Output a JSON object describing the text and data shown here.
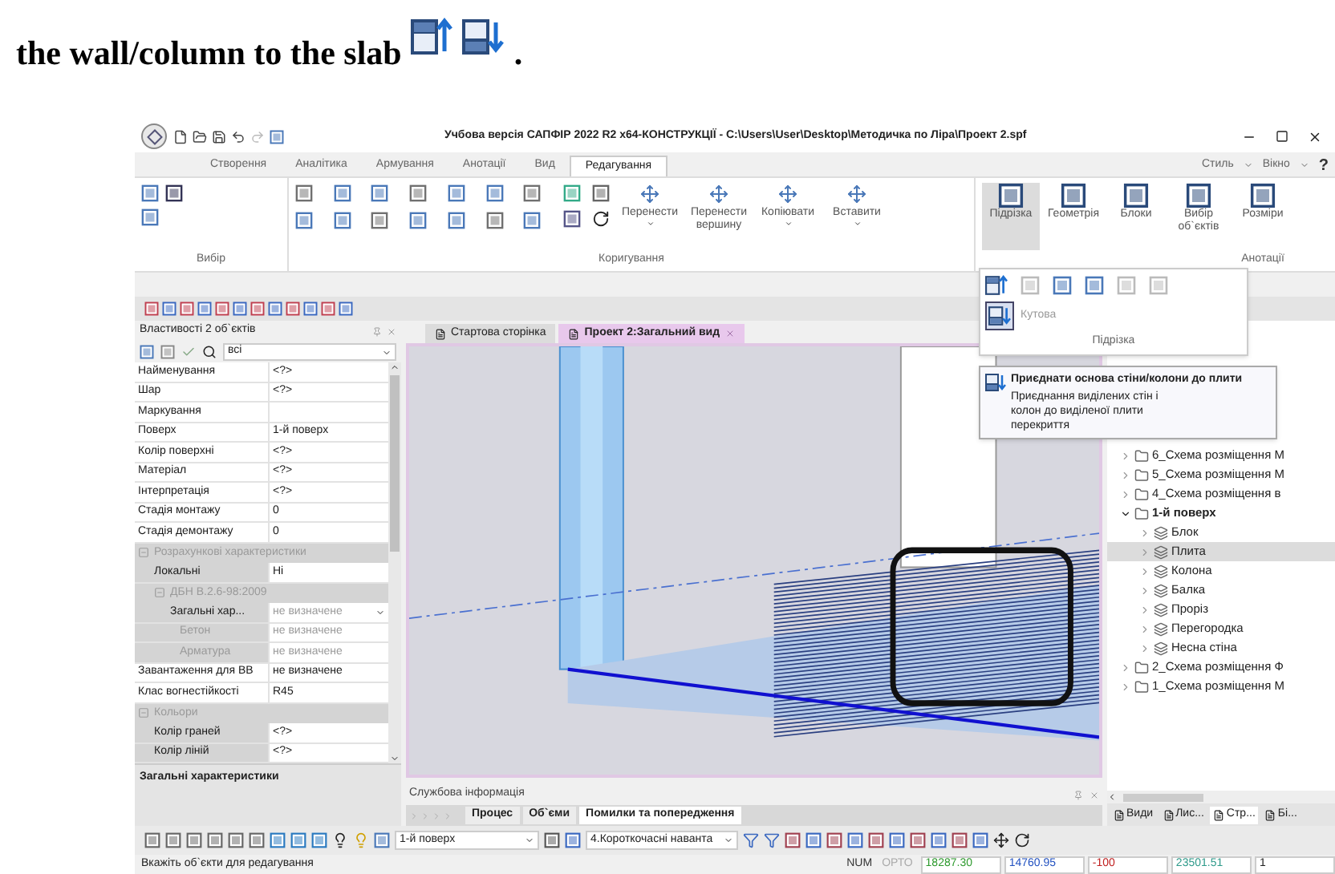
{
  "caption": {
    "text": "the wall/column to the slab",
    "end": "."
  },
  "window": {
    "title": "Учбова версія САПФІР 2022 R2 x64-КОНСТРУКЦІЇ - C:\\Users\\User\\Desktop\\Методичка по Ліра\\Проект 2.spf"
  },
  "ribbon_tabs": [
    {
      "label": "Створення",
      "selected": false
    },
    {
      "label": "Аналітика",
      "selected": false
    },
    {
      "label": "Армування",
      "selected": false
    },
    {
      "label": "Анотації",
      "selected": false
    },
    {
      "label": "Вид",
      "selected": false
    },
    {
      "label": "Редагування",
      "selected": true
    }
  ],
  "menu_right": [
    {
      "label": "Стиль",
      "dropdown": true
    },
    {
      "label": "Вікно",
      "dropdown": true
    },
    {
      "label": "?",
      "dropdown": false
    }
  ],
  "ribbon": {
    "select_group": "Вибір",
    "edit_group": "Коригування",
    "edit_buttons": [
      {
        "label": "Перенести",
        "dropdown": true
      },
      {
        "label": "Перенести вершину",
        "dropdown": false
      },
      {
        "label": "Копіювати",
        "dropdown": true
      },
      {
        "label": "Вставити",
        "dropdown": true
      }
    ],
    "large_buttons": [
      {
        "label": "Підрізка",
        "selected": true
      },
      {
        "label": "Геометрія",
        "selected": false
      },
      {
        "label": "Блоки",
        "selected": false
      },
      {
        "label": "Вибір об`єктів",
        "selected": false
      },
      {
        "label": "Розміри",
        "selected": false
      }
    ],
    "annot_group": "Анотації"
  },
  "trim_menu": {
    "button": "Кутова",
    "group": "Підрізка"
  },
  "tooltip": {
    "title": "Приєднати основа стіни/колони до плити",
    "body": "Приєднання виділених стін і колон до виділеної плити перекриття"
  },
  "properties": {
    "title": "Властивості 2 об`єктів",
    "filter": "всі",
    "description": "Загальні характеристики",
    "rows": [
      {
        "kind": "prop",
        "name": "Найменування",
        "value": "<?>"
      },
      {
        "kind": "prop",
        "name": "Шар",
        "value": "<?>"
      },
      {
        "kind": "prop",
        "name": "Маркування"
      },
      {
        "kind": "prop",
        "name": "Поверх",
        "value": "1-й поверх"
      },
      {
        "kind": "prop",
        "name": "Колір поверхні",
        "value": "<?>"
      },
      {
        "kind": "prop",
        "name": "Матеріал",
        "value": "<?>"
      },
      {
        "kind": "prop",
        "name": "Інтерпретація",
        "value": "<?>"
      },
      {
        "kind": "prop",
        "name": "Стадія монтажу",
        "value": "0"
      },
      {
        "kind": "prop",
        "name": "Стадія демонтажу",
        "value": "0"
      },
      {
        "kind": "section",
        "name": "Розрахункові характеристики",
        "expanded": true,
        "children": [
          {
            "kind": "prop",
            "name": "Локальні",
            "value": "Ні"
          },
          {
            "kind": "section",
            "name": "ДБН В.2.6-98:2009",
            "expanded": true,
            "children": [
              {
                "kind": "prop",
                "name": "Загальні хар...",
                "value": "не визначене",
                "dropdown": true,
                "disabled": false
              },
              {
                "kind": "prop",
                "name": "Бетон",
                "value": "не визначене",
                "disabled": true
              },
              {
                "kind": "prop",
                "name": "Арматура",
                "value": "не визначене",
                "disabled": true
              }
            ]
          }
        ]
      },
      {
        "kind": "prop",
        "name": "Завантаження для ВВ",
        "value": "не визначене"
      },
      {
        "kind": "prop",
        "name": "Клас вогнестійкості",
        "value": "R45"
      },
      {
        "kind": "section",
        "name": "Кольори",
        "expanded": true,
        "children": [
          {
            "kind": "prop",
            "name": "Колір граней",
            "value": "<?>"
          },
          {
            "kind": "prop",
            "name": "Колір ліній",
            "value": "<?>"
          }
        ]
      }
    ]
  },
  "doc_tabs": [
    {
      "label": "Стартова сторінка",
      "selected": false
    },
    {
      "label": "Проект 2:Загальний вид",
      "selected": true
    }
  ],
  "tree": [
    {
      "kind": "folder",
      "label": "6_Схема розміщення М",
      "expanded": false,
      "selected": false
    },
    {
      "kind": "folder",
      "label": "5_Схема розміщення М",
      "expanded": false,
      "selected": false
    },
    {
      "kind": "folder",
      "label": "4_Схема розміщення в",
      "expanded": false,
      "selected": false
    },
    {
      "kind": "folder",
      "label": "1-й поверх",
      "expanded": true,
      "selected": false,
      "current": true,
      "children": [
        {
          "kind": "layer",
          "label": "Блок",
          "expanded": false,
          "selected": false
        },
        {
          "kind": "layer",
          "label": "Плита",
          "expanded": false,
          "selected": true
        },
        {
          "kind": "layer",
          "label": "Колона",
          "expanded": false,
          "selected": false
        },
        {
          "kind": "layer",
          "label": "Балка",
          "expanded": false,
          "selected": false
        },
        {
          "kind": "layer",
          "label": "Проріз",
          "expanded": false,
          "selected": false
        },
        {
          "kind": "layer",
          "label": "Перегородка",
          "expanded": false,
          "selected": false
        },
        {
          "kind": "layer",
          "label": "Несна стіна",
          "expanded": false,
          "selected": false
        }
      ]
    },
    {
      "kind": "folder",
      "label": "2_Схема розміщення Ф",
      "expanded": false,
      "selected": false
    },
    {
      "kind": "folder",
      "label": "1_Схема розміщення М",
      "expanded": false,
      "selected": false
    }
  ],
  "service": {
    "title": "Службова інформація",
    "tabs": [
      {
        "label": "Процес",
        "selected": false
      },
      {
        "label": "Об`єми",
        "selected": false
      },
      {
        "label": "Помилки та попередження",
        "selected": true
      }
    ]
  },
  "panel_tabs": [
    {
      "label": "Види",
      "selected": false
    },
    {
      "label": "Лис...",
      "selected": false
    },
    {
      "label": "Стр...",
      "selected": true
    },
    {
      "label": "Бі...",
      "selected": false
    }
  ],
  "toolbar": {
    "floor": "1-й поверх",
    "load": "4.Короткочасні наванта"
  },
  "status": {
    "hint": "Вкажіть об`єкти для редагування",
    "cells": [
      {
        "text": "NUM",
        "kind": "label"
      },
      {
        "text": "ОРТО",
        "kind": "off"
      },
      {
        "text": "18287.30",
        "kind": "value",
        "color": "#2e9a2e"
      },
      {
        "text": "14760.95",
        "kind": "value",
        "color": "#2050c0"
      },
      {
        "text": "-100",
        "kind": "value",
        "color": "#c02020"
      },
      {
        "text": "23501.51",
        "kind": "value",
        "color": "#2e9a8a"
      },
      {
        "text": "1",
        "kind": "value",
        "color": "#202020"
      }
    ]
  }
}
